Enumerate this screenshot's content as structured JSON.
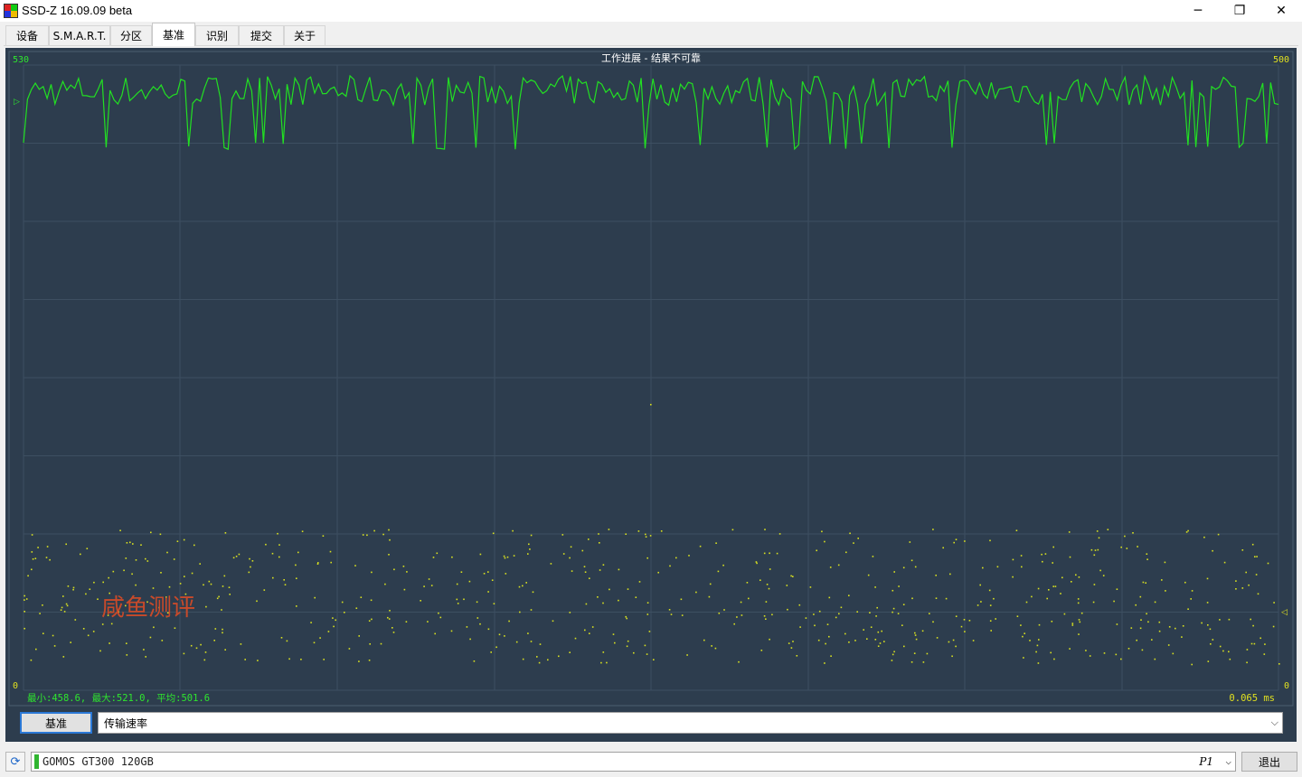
{
  "window": {
    "title": "SSD-Z 16.09.09 beta",
    "min_glyph": "─",
    "max_glyph": "❐",
    "close_glyph": "✕"
  },
  "tabs": [
    {
      "label": "设备"
    },
    {
      "label": "S.M.A.R.T."
    },
    {
      "label": "分区"
    },
    {
      "label": "基准",
      "active": true
    },
    {
      "label": "识别"
    },
    {
      "label": "提交"
    },
    {
      "label": "关于"
    }
  ],
  "benchmark": {
    "header_text": "工作进展 - 结果不可靠",
    "left_axis_top": "530",
    "left_axis_bottom": "0",
    "right_axis_top": "500",
    "right_axis_bottom": "0",
    "left_marker": "▷",
    "right_marker": "◁",
    "stats_text": "最小:458.6, 最大:521.0, 平均:501.6",
    "latency_text": "0.065 ms",
    "watermark": "咸鱼测评",
    "run_button": "基准",
    "metric_selected": "传输速率"
  },
  "chart_data": {
    "type": "line",
    "title": "工作进展 - 结果不可靠",
    "series": [
      {
        "name": "传输速率",
        "axis": "left",
        "ylim": [
          0,
          530
        ],
        "stats": {
          "min": 458.6,
          "max": 521.0,
          "avg": 501.6
        }
      },
      {
        "name": "",
        "axis": "right",
        "kind": "scatter",
        "ylim": [
          0,
          500
        ],
        "unit": "ms",
        "current": 0.065
      }
    ],
    "grid": true,
    "colors": {
      "line": "#22e022",
      "scatter": "#d8e020",
      "background": "#2d3d4e",
      "grid": "#3d4f61",
      "text_green": "#2ee62e",
      "text_yellow": "#e0e020"
    }
  },
  "statusbar": {
    "refresh_icon": "⟳",
    "drive_name": "GOMOS GT300 120GB",
    "partition": "P1",
    "exit_button": "退出"
  }
}
